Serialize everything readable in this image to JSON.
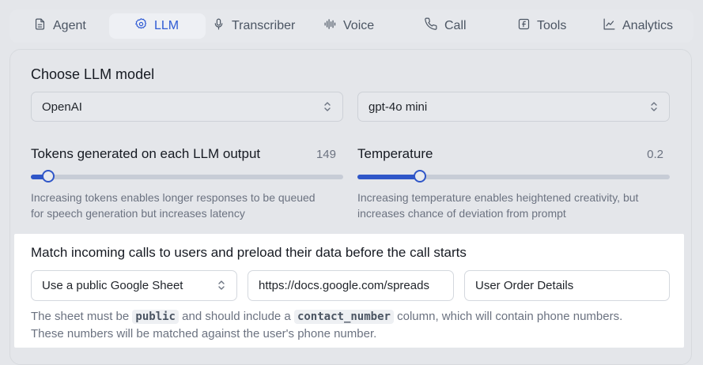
{
  "tabs": [
    {
      "label": "Agent",
      "icon": "document-icon",
      "active": false
    },
    {
      "label": "LLM",
      "icon": "gear-icon",
      "active": true
    },
    {
      "label": "Transcriber",
      "icon": "microphone-icon",
      "active": false
    },
    {
      "label": "Voice",
      "icon": "waveform-icon",
      "active": false
    },
    {
      "label": "Call",
      "icon": "phone-icon",
      "active": false
    },
    {
      "label": "Tools",
      "icon": "function-icon",
      "active": false
    },
    {
      "label": "Analytics",
      "icon": "chart-line-icon",
      "active": false
    }
  ],
  "colors": {
    "accent": "#2f56c8",
    "active_tab_text": "#2f5bd4",
    "muted": "#6b7280"
  },
  "llm": {
    "section_title": "Choose LLM model",
    "provider_value": "OpenAI",
    "model_value": "gpt-4o mini"
  },
  "tokens": {
    "label": "Tokens generated on each LLM output",
    "value": "149",
    "fraction": 0.055,
    "hint_line1": "Increasing tokens enables longer responses to be queued",
    "hint_line2": "for speech generation but increases latency"
  },
  "temperature": {
    "label": "Temperature",
    "value": "0.2",
    "fraction": 0.2,
    "hint_line1": "Increasing temperature enables heightened creativity, but",
    "hint_line2": "increases chance of deviation from prompt"
  },
  "match": {
    "title": "Match incoming calls to users and preload their data before the call starts",
    "source_select": "Use a public Google Sheet",
    "url_value": "https://docs.google.com/spreads",
    "name_value": "User Order Details",
    "desc_part1": "The sheet must be ",
    "desc_code1": "public",
    "desc_part2": " and should include a ",
    "desc_code2": "contact_number",
    "desc_part3": " column, which will contain phone numbers.",
    "desc_line2": "These numbers will be matched against the user's phone number."
  }
}
